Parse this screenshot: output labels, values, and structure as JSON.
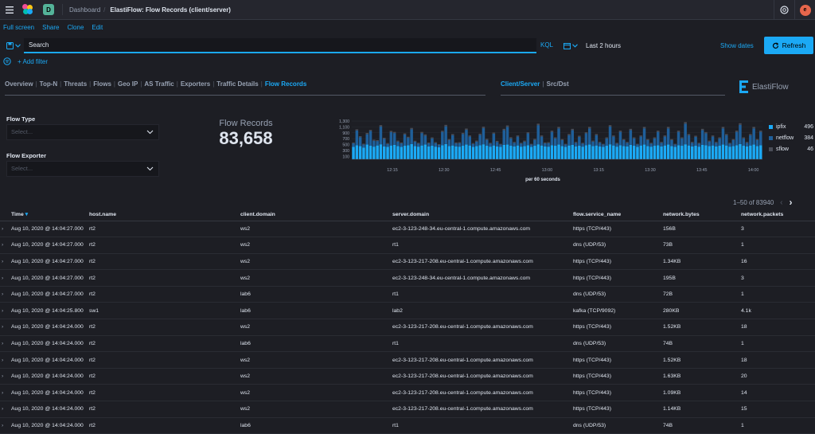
{
  "header": {
    "space_initial": "D",
    "breadcrumb_root": "Dashboard",
    "breadcrumb_current": "ElastiFlow: Flow Records (client/server)",
    "avatar_initial": "e"
  },
  "actions": [
    "Full screen",
    "Share",
    "Clone",
    "Edit"
  ],
  "query": {
    "placeholder": "Search",
    "language": "KQL",
    "time_range": "Last 2 hours",
    "show_dates": "Show dates",
    "refresh": "Refresh",
    "add_filter": "+ Add filter"
  },
  "nav": {
    "tabs": [
      "Overview",
      "Top-N",
      "Threats",
      "Flows",
      "Geo IP",
      "AS Traffic",
      "Exporters",
      "Traffic Details",
      "Flow Records"
    ],
    "active_tab": "Flow Records",
    "view_tabs": [
      "Client/Server",
      "Src/Dst"
    ],
    "brand": "ElastiFlow"
  },
  "controls": {
    "flow_type_label": "Flow Type",
    "flow_type_placeholder": "Select...",
    "flow_exporter_label": "Flow Exporter",
    "flow_exporter_placeholder": "Select..."
  },
  "metric": {
    "label": "Flow Records",
    "value": "83,658"
  },
  "chart_data": {
    "type": "bar",
    "stacked": true,
    "xlabel": "per 60 seconds",
    "x_ticks": [
      "12:15",
      "12:30",
      "12:45",
      "13:00",
      "13:15",
      "13:30",
      "13:45",
      "14:00"
    ],
    "y_ticks": [
      "100",
      "300",
      "500",
      "700",
      "900",
      "1,100",
      "1,300"
    ],
    "ylim": [
      0,
      1300
    ],
    "colors": {
      "ipfix": "#1ba9f5",
      "netflow": "#1f5f9a",
      "sflow": "#4a4d57"
    },
    "series": [
      {
        "name": "ipfix",
        "values": [
          420,
          480,
          450,
          400,
          500,
          460,
          430,
          470,
          510,
          440,
          420,
          470,
          490,
          450,
          420,
          460,
          480,
          520,
          450,
          430,
          470,
          500,
          440,
          460,
          430,
          410,
          480,
          520,
          450,
          470,
          440,
          430,
          460,
          500,
          470,
          420,
          450,
          480,
          510,
          460,
          430,
          470,
          440,
          420,
          490,
          500,
          460,
          440,
          470,
          430,
          450,
          480,
          420,
          460,
          510,
          470,
          440,
          430,
          480,
          460,
          500,
          450,
          420,
          470,
          490,
          440,
          460,
          430,
          480,
          500,
          450,
          470,
          440,
          420,
          460,
          510,
          470,
          430,
          480,
          450,
          440,
          490,
          460,
          420,
          470,
          500,
          450,
          430,
          460,
          480,
          440,
          470,
          500,
          450,
          420,
          480,
          460,
          510,
          470,
          440,
          460,
          430,
          490,
          480,
          450,
          470,
          440,
          460,
          500,
          470,
          430,
          450,
          480,
          520,
          460,
          440,
          470,
          500,
          450,
          480
        ]
      },
      {
        "name": "netflow",
        "values": [
          120,
          500,
          300,
          100,
          350,
          500,
          200,
          150,
          600,
          250,
          100,
          450,
          400,
          150,
          120,
          380,
          250,
          500,
          150,
          100,
          420,
          300,
          100,
          250,
          120,
          80,
          450,
          600,
          200,
          350,
          100,
          120,
          400,
          500,
          300,
          100,
          150,
          350,
          550,
          200,
          100,
          400,
          150,
          80,
          500,
          600,
          250,
          120,
          300,
          100,
          150,
          400,
          80,
          200,
          650,
          300,
          100,
          120,
          450,
          250,
          550,
          200,
          80,
          350,
          500,
          120,
          300,
          100,
          400,
          550,
          150,
          350,
          120,
          80,
          250,
          600,
          300,
          100,
          450,
          200,
          120,
          500,
          250,
          80,
          300,
          550,
          200,
          100,
          250,
          450,
          120,
          300,
          550,
          200,
          80,
          450,
          250,
          700,
          350,
          120,
          300,
          100,
          500,
          400,
          150,
          300,
          120,
          250,
          550,
          350,
          100,
          200,
          450,
          650,
          250,
          120,
          350,
          550,
          200,
          450
        ]
      },
      {
        "name": "sflow",
        "values": [
          30,
          40,
          35,
          30,
          45,
          40,
          35,
          30,
          50,
          40,
          30,
          45,
          40,
          35,
          30,
          40,
          35,
          45,
          30,
          30,
          40,
          45,
          30,
          35,
          30,
          25,
          40,
          50,
          35,
          40,
          30,
          30,
          40,
          45,
          40,
          30,
          35,
          40,
          50,
          35,
          30,
          40,
          35,
          25,
          45,
          50,
          40,
          30,
          40,
          30,
          35,
          40,
          25,
          35,
          50,
          40,
          30,
          30,
          45,
          35,
          50,
          35,
          25,
          40,
          45,
          30,
          40,
          30,
          40,
          50,
          35,
          40,
          30,
          25,
          35,
          50,
          40,
          30,
          45,
          35,
          30,
          45,
          35,
          25,
          40,
          50,
          35,
          30,
          35,
          45,
          30,
          40,
          50,
          35,
          25,
          45,
          35,
          55,
          40,
          30,
          40,
          30,
          45,
          45,
          35,
          40,
          30,
          35,
          50,
          40,
          30,
          35,
          45,
          55,
          35,
          30,
          40,
          50,
          35,
          45
        ]
      }
    ],
    "legend": [
      {
        "name": "ipfix",
        "count": "496"
      },
      {
        "name": "netflow",
        "count": "384"
      },
      {
        "name": "sflow",
        "count": "46"
      }
    ]
  },
  "pagination": {
    "text": "1–50 of 83940"
  },
  "table": {
    "columns": [
      "Time",
      "host.name",
      "client.domain",
      "server.domain",
      "flow.service_name",
      "network.bytes",
      "network.packets"
    ],
    "rows": [
      [
        "Aug 10, 2020 @ 14:04:27.000",
        "rt2",
        "ws2",
        "ec2-3-123-248-34.eu-central-1.compute.amazonaws.com",
        "https (TCP/443)",
        "156B",
        "3"
      ],
      [
        "Aug 10, 2020 @ 14:04:27.000",
        "rt2",
        "ws2",
        "rt1",
        "dns (UDP/53)",
        "73B",
        "1"
      ],
      [
        "Aug 10, 2020 @ 14:04:27.000",
        "rt2",
        "ws2",
        "ec2-3-123-217-208.eu-central-1.compute.amazonaws.com",
        "https (TCP/443)",
        "1.34KB",
        "16"
      ],
      [
        "Aug 10, 2020 @ 14:04:27.000",
        "rt2",
        "ws2",
        "ec2-3-123-248-34.eu-central-1.compute.amazonaws.com",
        "https (TCP/443)",
        "195B",
        "3"
      ],
      [
        "Aug 10, 2020 @ 14:04:27.000",
        "rt2",
        "lab6",
        "rt1",
        "dns (UDP/53)",
        "72B",
        "1"
      ],
      [
        "Aug 10, 2020 @ 14:04:25.800",
        "sw1",
        "lab6",
        "lab2",
        "kafka (TCP/9092)",
        "280KB",
        "4.1k"
      ],
      [
        "Aug 10, 2020 @ 14:04:24.000",
        "rt2",
        "ws2",
        "ec2-3-123-217-208.eu-central-1.compute.amazonaws.com",
        "https (TCP/443)",
        "1.52KB",
        "18"
      ],
      [
        "Aug 10, 2020 @ 14:04:24.000",
        "rt2",
        "lab6",
        "rt1",
        "dns (UDP/53)",
        "74B",
        "1"
      ],
      [
        "Aug 10, 2020 @ 14:04:24.000",
        "rt2",
        "ws2",
        "ec2-3-123-217-208.eu-central-1.compute.amazonaws.com",
        "https (TCP/443)",
        "1.52KB",
        "18"
      ],
      [
        "Aug 10, 2020 @ 14:04:24.000",
        "rt2",
        "ws2",
        "ec2-3-123-217-208.eu-central-1.compute.amazonaws.com",
        "https (TCP/443)",
        "1.63KB",
        "20"
      ],
      [
        "Aug 10, 2020 @ 14:04:24.000",
        "rt2",
        "ws2",
        "ec2-3-123-217-208.eu-central-1.compute.amazonaws.com",
        "https (TCP/443)",
        "1.09KB",
        "14"
      ],
      [
        "Aug 10, 2020 @ 14:04:24.000",
        "rt2",
        "ws2",
        "ec2-3-123-217-208.eu-central-1.compute.amazonaws.com",
        "https (TCP/443)",
        "1.14KB",
        "15"
      ],
      [
        "Aug 10, 2020 @ 14:04:24.000",
        "rt2",
        "lab6",
        "rt1",
        "dns (UDP/53)",
        "74B",
        "1"
      ]
    ]
  }
}
